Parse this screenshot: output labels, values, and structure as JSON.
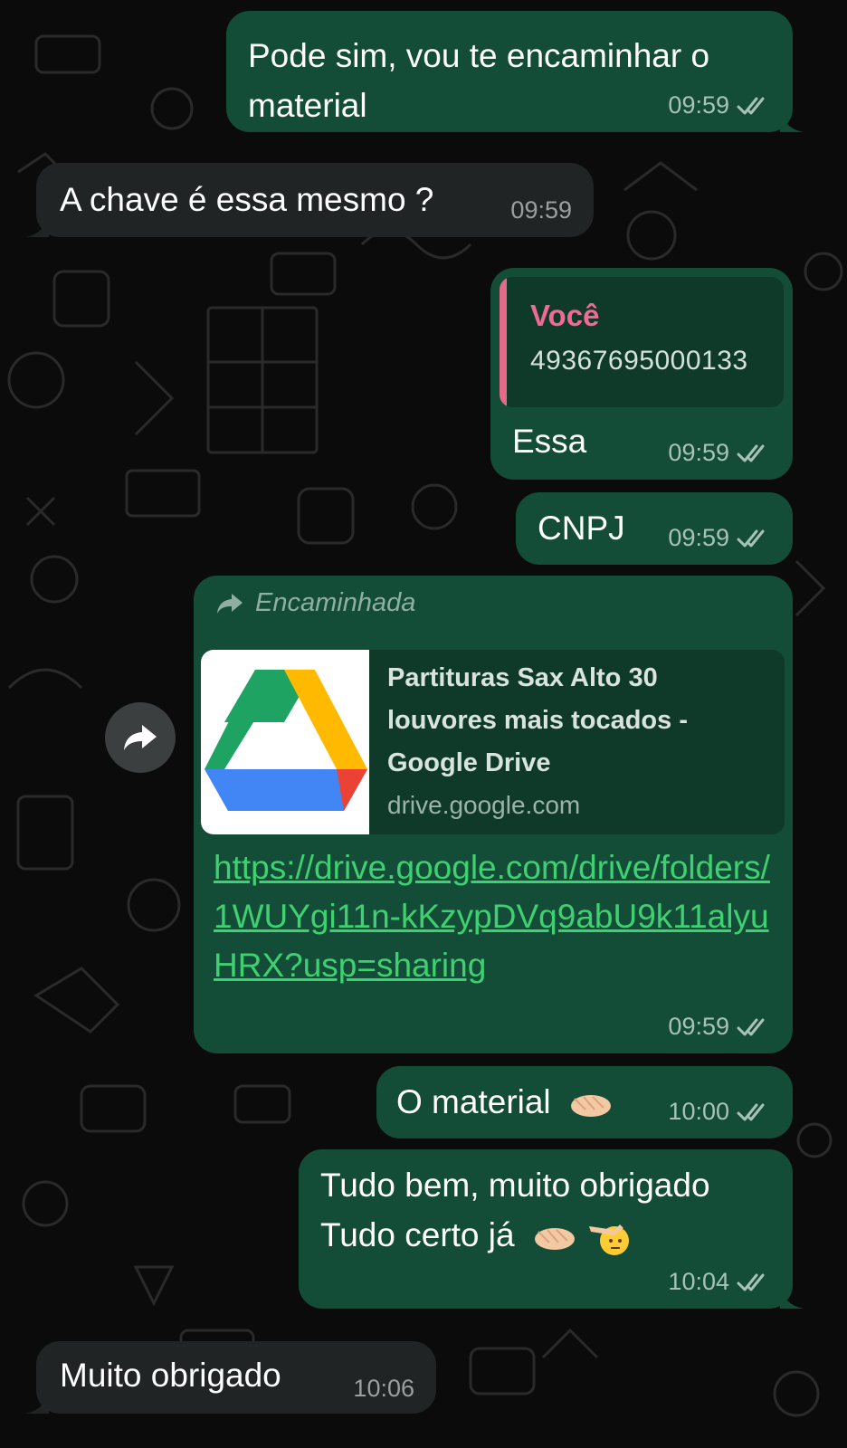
{
  "messages": [
    {
      "id": "m1",
      "dir": "out",
      "text_lines": [
        "Pode sim, vou te encaminhar o",
        "material"
      ],
      "time": "09:59"
    },
    {
      "id": "m2",
      "dir": "in",
      "text": "A chave é essa mesmo ?",
      "time": "09:59"
    },
    {
      "id": "m3",
      "dir": "out",
      "quote": {
        "author": "Você",
        "text": "49367695000133"
      },
      "text": "Essa",
      "time": "09:59"
    },
    {
      "id": "m4",
      "dir": "out",
      "text": "CNPJ",
      "time": "09:59"
    },
    {
      "id": "m5",
      "dir": "out",
      "forwarded_label": "Encaminhada",
      "link_preview": {
        "title": "Partituras Sax Alto 30 louvores mais tocados - Google Drive",
        "domain": "drive.google.com"
      },
      "url": "https://drive.google.com/drive/folders/1WUYgi11n-kKzypDVq9abU9k11alyuHRX?usp=sharing",
      "time": "09:59"
    },
    {
      "id": "m6",
      "dir": "out",
      "text": "O material",
      "time": "10:00"
    },
    {
      "id": "m7",
      "dir": "out",
      "text_lines": [
        "Tudo bem, muito obrigado",
        "Tudo certo já"
      ],
      "time": "10:04"
    },
    {
      "id": "m8",
      "dir": "in",
      "text": "Muito obrigado",
      "time": "10:06"
    }
  ],
  "colors": {
    "outgoing_bubble": "#134d37",
    "incoming_bubble": "#202424",
    "link": "#3fd071",
    "quote_author": "#f06a93",
    "background": "#0b0b0b"
  },
  "icons": [
    "double-check-icon",
    "forward-icon",
    "google-drive-icon",
    "share-icon",
    "handshake-emoji",
    "pointing-left-emoji",
    "saluting-face-emoji"
  ]
}
